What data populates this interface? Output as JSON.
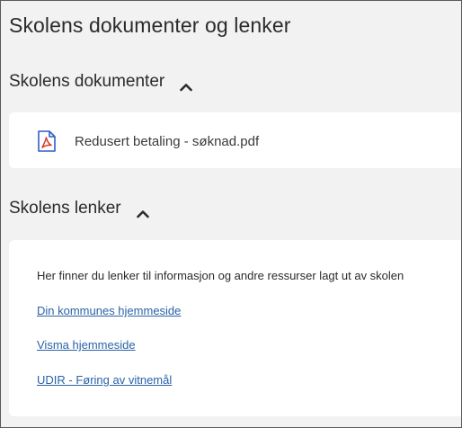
{
  "page": {
    "title": "Skolens dokumenter og lenker"
  },
  "documents": {
    "heading": "Skolens dokumenter",
    "toggle_icon": "chevron-up-icon",
    "items": [
      {
        "name": "Redusert betaling - søknad.pdf",
        "icon": "pdf-file-icon"
      }
    ]
  },
  "links": {
    "heading": "Skolens lenker",
    "toggle_icon": "chevron-up-icon",
    "intro": "Her finner du lenker til informasjon og andre ressurser lagt ut av skolen",
    "items": [
      {
        "label": "Din kommunes hjemmeside"
      },
      {
        "label": "Visma hjemmeside"
      },
      {
        "label": "UDIR - Føring av vitnemål"
      }
    ]
  },
  "colors": {
    "background": "#f2f2f2",
    "card": "#ffffff",
    "link": "#2a63a8",
    "pdf_icon_blue": "#2f5fc4",
    "pdf_icon_red": "#d63a2f"
  }
}
